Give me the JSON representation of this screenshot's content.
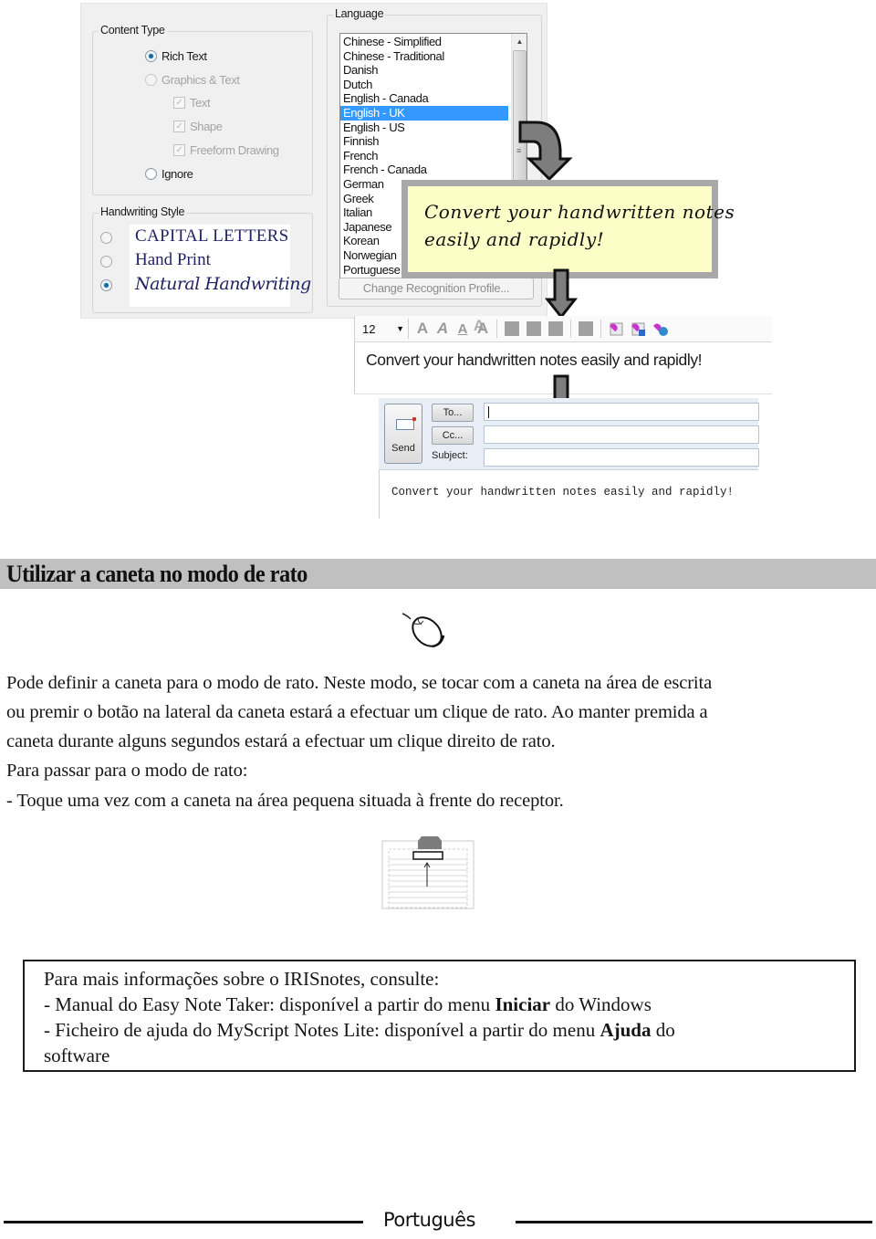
{
  "options_dialog": {
    "content_type": {
      "legend": "Content Type",
      "options": [
        {
          "label": "Rich Text",
          "selected": true,
          "enabled": true
        },
        {
          "label": "Graphics & Text",
          "selected": false,
          "enabled": false
        },
        {
          "label": "Ignore",
          "selected": false,
          "enabled": true
        }
      ],
      "sub_checks": [
        {
          "label": "Text",
          "checked": true,
          "enabled": false
        },
        {
          "label": "Shape",
          "checked": true,
          "enabled": false
        },
        {
          "label": "Freeform Drawing",
          "checked": true,
          "enabled": false
        }
      ]
    },
    "handwriting_style": {
      "legend": "Handwriting Style",
      "options": [
        {
          "label": "CAPITAL LETTERS",
          "selected": false
        },
        {
          "label": "Hand Print",
          "selected": false
        },
        {
          "label": "Natural Handwriting",
          "selected": true
        }
      ]
    },
    "language": {
      "legend": "Language",
      "items": [
        "Chinese - Simplified",
        "Chinese - Traditional",
        "Danish",
        "Dutch",
        "English - Canada",
        "English - UK",
        "English - US",
        "Finnish",
        "French",
        "French - Canada",
        "German",
        "Greek",
        "Italian",
        "Japanese",
        "Korean",
        "Norwegian",
        "Portuguese"
      ],
      "selected": "English - UK"
    },
    "change_profile_button": "Change Recognition Profile..."
  },
  "sticky_note": {
    "lines": [
      "Convert your handwritten notes",
      "easily and rapidly!"
    ]
  },
  "editor": {
    "font_size": "12",
    "text": "Convert your handwritten notes easily and rapidly!"
  },
  "email": {
    "send_label": "Send",
    "to_label": "To...",
    "cc_label": "Cc...",
    "subject_label": "Subject:",
    "to_value": "",
    "cc_value": "",
    "subject_value": "",
    "body": "Convert your handwritten notes easily and rapidly!"
  },
  "section": {
    "title": "Utilizar a caneta no modo de rato",
    "paragraph_lines": [
      "Pode definir a caneta para o modo de rato. Neste modo, se tocar com a caneta na área de escrita",
      "ou premir o botão na lateral da caneta estará a efectuar um clique de rato. Ao manter premida a",
      "caneta durante alguns segundos estará a efectuar um clique direito de rato.",
      "Para passar para o modo de rato:",
      "- Toque uma vez com a caneta na área pequena situada à frente do receptor."
    ]
  },
  "info_box": {
    "line1": "Para mais informações sobre o IRISnotes, consulte:",
    "line2": {
      "prefix": "- Manual do Easy Note Taker: disponível a partir do menu ",
      "bold": "Iniciar",
      "suffix": " do Windows"
    },
    "line3": {
      "prefix": "- Ficheiro de ajuda do MyScript Notes Lite: disponível a partir do menu ",
      "bold": "Ajuda",
      "suffix": " do"
    },
    "line4": "software"
  },
  "footer": {
    "language": "Português"
  },
  "icons": {
    "mouse": "mouse-icon",
    "receptor": "receptor-diagram-icon",
    "arrows": "down-arrow-icon"
  }
}
